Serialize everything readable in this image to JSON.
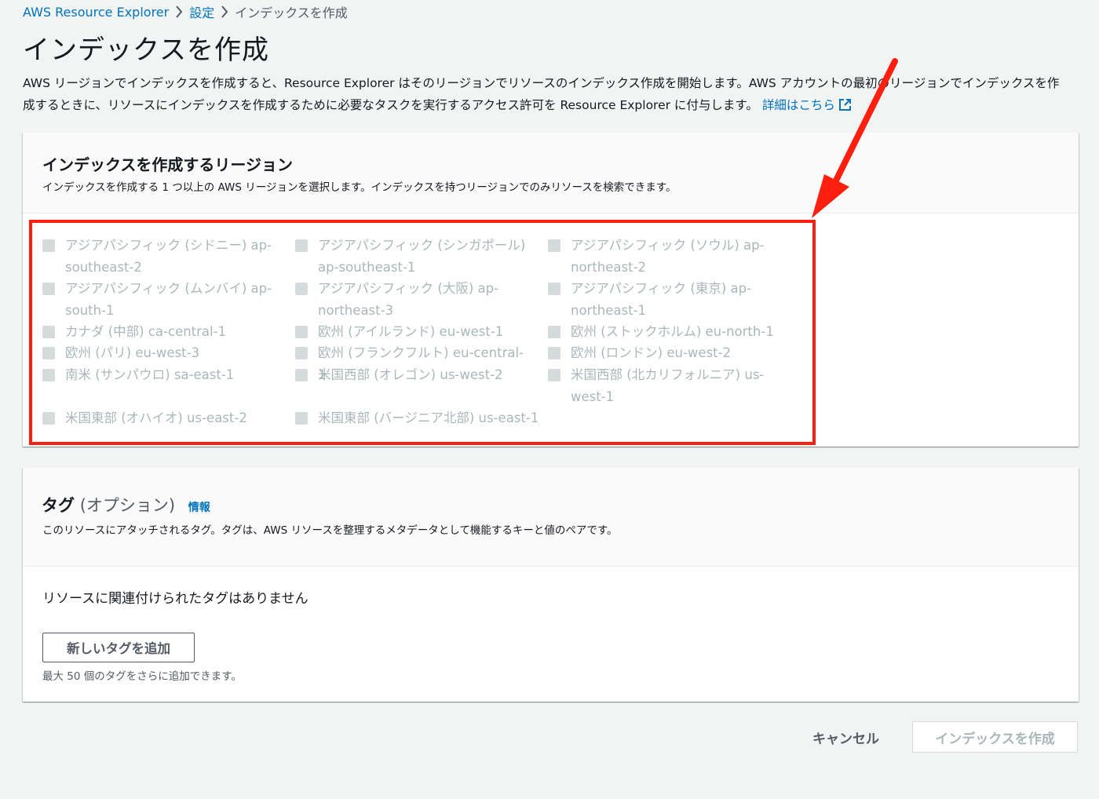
{
  "breadcrumb": {
    "items": [
      "AWS Resource Explorer",
      "設定",
      "インデックスを作成"
    ]
  },
  "page": {
    "title": "インデックスを作成",
    "description": "AWS リージョンでインデックスを作成すると、Resource Explorer はそのリージョンでリソースのインデックス作成を開始します。AWS アカウントの最初のリージョンでインデックスを作成するときに、リソースにインデックスを作成するために必要なタスクを実行するアクセス許可を Resource Explorer に付与します。",
    "learn_more": "詳細はこちら"
  },
  "regions_panel": {
    "title": "インデックスを作成するリージョン",
    "description": "インデックスを作成する 1 つ以上の AWS リージョンを選択します。インデックスを持つリージョンでのみリソースを検索できます。",
    "regions": [
      {
        "label": "アジアパシフィック (シドニー) ap-southeast-2",
        "checked": false,
        "disabled": true
      },
      {
        "label": "アジアパシフィック (シンガポール) ap-southeast-1",
        "checked": false,
        "disabled": true
      },
      {
        "label": "アジアパシフィック (ソウル) ap-northeast-2",
        "checked": false,
        "disabled": true
      },
      {
        "label": "アジアパシフィック (ムンバイ) ap-south-1",
        "checked": false,
        "disabled": true
      },
      {
        "label": "アジアパシフィック (大阪) ap-northeast-3",
        "checked": false,
        "disabled": true
      },
      {
        "label": "アジアパシフィック (東京) ap-northeast-1",
        "checked": false,
        "disabled": true
      },
      {
        "label": "カナダ (中部) ca-central-1",
        "checked": false,
        "disabled": true
      },
      {
        "label": "欧州 (アイルランド) eu-west-1",
        "checked": false,
        "disabled": true
      },
      {
        "label": "欧州 (ストックホルム) eu-north-1",
        "checked": false,
        "disabled": true
      },
      {
        "label": "欧州 (パリ) eu-west-3",
        "checked": false,
        "disabled": true
      },
      {
        "label": "欧州 (フランクフルト) eu-central-1",
        "checked": false,
        "disabled": true
      },
      {
        "label": "欧州 (ロンドン) eu-west-2",
        "checked": false,
        "disabled": true
      },
      {
        "label": "南米 (サンパウロ) sa-east-1",
        "checked": false,
        "disabled": true
      },
      {
        "label": "米国西部 (オレゴン) us-west-2",
        "checked": false,
        "disabled": true
      },
      {
        "label": "米国西部 (北カリフォルニア) us-west-1",
        "checked": false,
        "disabled": true
      },
      {
        "label": "米国東部 (オハイオ) us-east-2",
        "checked": false,
        "disabled": true
      },
      {
        "label": "米国東部 (バージニア北部) us-east-1",
        "checked": false,
        "disabled": true
      }
    ]
  },
  "tags_panel": {
    "title": "タグ",
    "optional": "(オプション)",
    "info": "情報",
    "description": "このリソースにアタッチされるタグ。タグは、AWS リソースを整理するメタデータとして機能するキーと値のペアです。",
    "empty_text": "リソースに関連付けられたタグはありません",
    "add_button": "新しいタグを追加",
    "hint": "最大 50 個のタグをさらに追加できます。"
  },
  "footer": {
    "cancel": "キャンセル",
    "create": "インデックスを作成"
  },
  "colors": {
    "link": "#0073bb",
    "annotation_red": "#ff1f0f",
    "disabled_text": "#aab7b8",
    "background": "#f2f3f3"
  }
}
